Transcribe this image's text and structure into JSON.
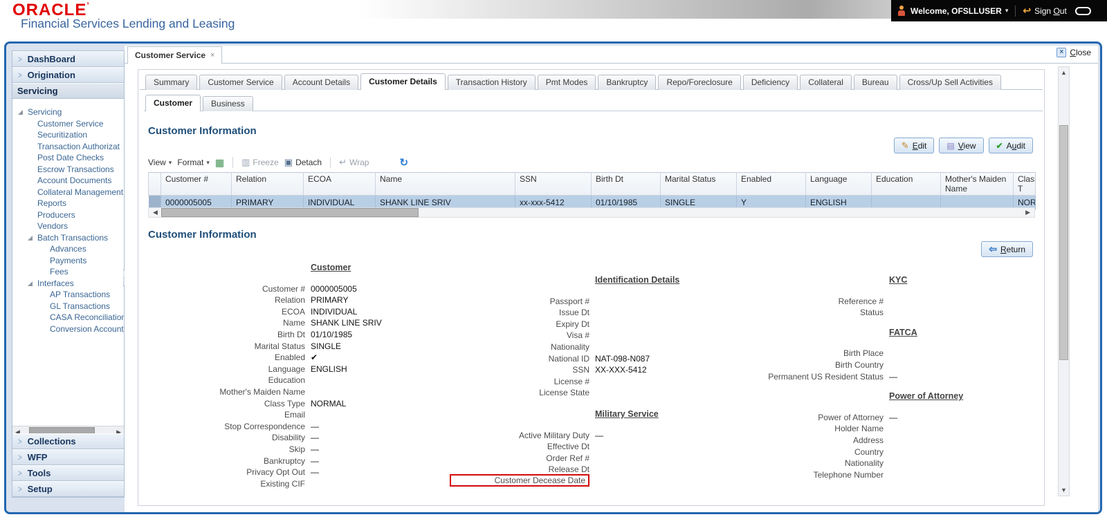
{
  "header": {
    "logo": "ORACLE",
    "logo_mark": "’",
    "product": "Financial Services Lending and Leasing",
    "welcome": "Welcome, OFSLLUSER",
    "sign_out": {
      "pre": "Sign ",
      "key": "O",
      "post": "ut"
    }
  },
  "sidebar": {
    "accordions_top": [
      "DashBoard",
      "Origination"
    ],
    "active_accordion": "Servicing",
    "tree": [
      {
        "label": "Servicing"
      },
      {
        "label": "Customer Service"
      },
      {
        "label": "Securitization"
      },
      {
        "label": "Transaction Authorizat"
      },
      {
        "label": "Post Date Checks"
      },
      {
        "label": "Escrow Transactions"
      },
      {
        "label": "Account Documents"
      },
      {
        "label": "Collateral Management"
      },
      {
        "label": "Reports"
      },
      {
        "label": "Producers"
      },
      {
        "label": "Vendors"
      },
      {
        "label": "Batch Transactions"
      },
      {
        "label": "Advances"
      },
      {
        "label": "Payments"
      },
      {
        "label": "Fees"
      },
      {
        "label": "Interfaces"
      },
      {
        "label": "AP Transactions"
      },
      {
        "label": "GL Transactions"
      },
      {
        "label": "CASA Reconciliation"
      },
      {
        "label": "Conversion Account"
      }
    ],
    "accordions_bottom": [
      "Collections",
      "WFP",
      "Tools",
      "Setup"
    ]
  },
  "window": {
    "doc_tab": "Customer Service",
    "doc_tab_close": "×",
    "close_icon": "×",
    "close": {
      "key": "C",
      "post": "lose"
    }
  },
  "tabs": [
    "Summary",
    "Customer Service",
    "Account Details",
    "Customer Details",
    "Transaction History",
    "Pmt Modes",
    "Bankruptcy",
    "Repo/Foreclosure",
    "Deficiency",
    "Collateral",
    "Bureau",
    "Cross/Up Sell Activities"
  ],
  "subtabs": [
    "Customer",
    "Business"
  ],
  "grid": {
    "title": "Customer Information",
    "buttons": {
      "edit": {
        "pre": "",
        "key": "E",
        "post": "dit"
      },
      "view": {
        "pre": "",
        "key": "V",
        "post": "iew"
      },
      "audit": {
        "pre": "A",
        "key": "u",
        "post": "dit"
      }
    },
    "toolbar": {
      "view": "View",
      "format": "Format",
      "freeze": "Freeze",
      "detach": "Detach",
      "wrap": "Wrap"
    },
    "columns": [
      "Customer #",
      "Relation",
      "ECOA",
      "Name",
      "SSN",
      "Birth Dt",
      "Marital Status",
      "Enabled",
      "Language",
      "Education",
      "Mother's Maiden Name",
      "Class T"
    ],
    "row": [
      "0000005005",
      "PRIMARY",
      "INDIVIDUAL",
      "SHANK LINE SRIV",
      "xx-xxx-5412",
      "01/10/1985",
      "SINGLE",
      "Y",
      "ENGLISH",
      "",
      "",
      "NORMA"
    ]
  },
  "detail": {
    "title": "Customer Information",
    "return_btn": {
      "key": "R",
      "post": "eturn"
    },
    "customer": {
      "header": "Customer",
      "fields": [
        {
          "label": "Customer #",
          "value": "0000005005"
        },
        {
          "label": "Relation",
          "value": "PRIMARY"
        },
        {
          "label": "ECOA",
          "value": "INDIVIDUAL"
        },
        {
          "label": "Name",
          "value": "SHANK LINE SRIV"
        },
        {
          "label": "Birth Dt",
          "value": "01/10/1985"
        },
        {
          "label": "Marital Status",
          "value": "SINGLE"
        },
        {
          "label": "Enabled",
          "value": "✔"
        },
        {
          "label": "Language",
          "value": "ENGLISH"
        },
        {
          "label": "Education",
          "value": ""
        },
        {
          "label": "Mother's Maiden Name",
          "value": ""
        },
        {
          "label": "Class Type",
          "value": "NORMAL"
        },
        {
          "label": "Email",
          "value": ""
        },
        {
          "label": "Stop Correspondence",
          "value": "—"
        },
        {
          "label": "Disability",
          "value": "—"
        },
        {
          "label": "Skip",
          "value": "—"
        },
        {
          "label": "Bankruptcy",
          "value": "—"
        },
        {
          "label": "Privacy Opt Out",
          "value": "—"
        },
        {
          "label": "Existing CIF",
          "value": ""
        }
      ]
    },
    "identification": {
      "header": "Identification Details",
      "fields": [
        {
          "label": "Passport #",
          "value": ""
        },
        {
          "label": "Issue Dt",
          "value": ""
        },
        {
          "label": "Expiry Dt",
          "value": ""
        },
        {
          "label": "Visa #",
          "value": ""
        },
        {
          "label": "Nationality",
          "value": ""
        },
        {
          "label": "National ID",
          "value": "NAT-098-N087"
        },
        {
          "label": "SSN",
          "value": "XX-XXX-5412"
        },
        {
          "label": "License #",
          "value": ""
        },
        {
          "label": "License State",
          "value": ""
        }
      ]
    },
    "military": {
      "header": "Military Service",
      "fields": [
        {
          "label": "Active Military Duty",
          "value": "—"
        },
        {
          "label": "Effective Dt",
          "value": ""
        },
        {
          "label": "Order Ref #",
          "value": ""
        },
        {
          "label": "Release Dt",
          "value": ""
        },
        {
          "label": "Customer Decease Date",
          "value": ""
        }
      ]
    },
    "kyc": {
      "header": "KYC",
      "fields": [
        {
          "label": "Reference #",
          "value": ""
        },
        {
          "label": "Status",
          "value": ""
        }
      ]
    },
    "fatca": {
      "header": "FATCA",
      "fields": [
        {
          "label": "Birth Place",
          "value": ""
        },
        {
          "label": "Birth Country",
          "value": ""
        },
        {
          "label": "Permanent US Resident Status",
          "value": "—"
        }
      ]
    },
    "poa": {
      "header": "Power of Attorney",
      "fields": [
        {
          "label": "Power of Attorney",
          "value": "—"
        },
        {
          "label": "Holder Name",
          "value": ""
        },
        {
          "label": "Address",
          "value": ""
        },
        {
          "label": "Country",
          "value": ""
        },
        {
          "label": "Nationality",
          "value": ""
        },
        {
          "label": "Telephone Number",
          "value": ""
        }
      ]
    }
  }
}
